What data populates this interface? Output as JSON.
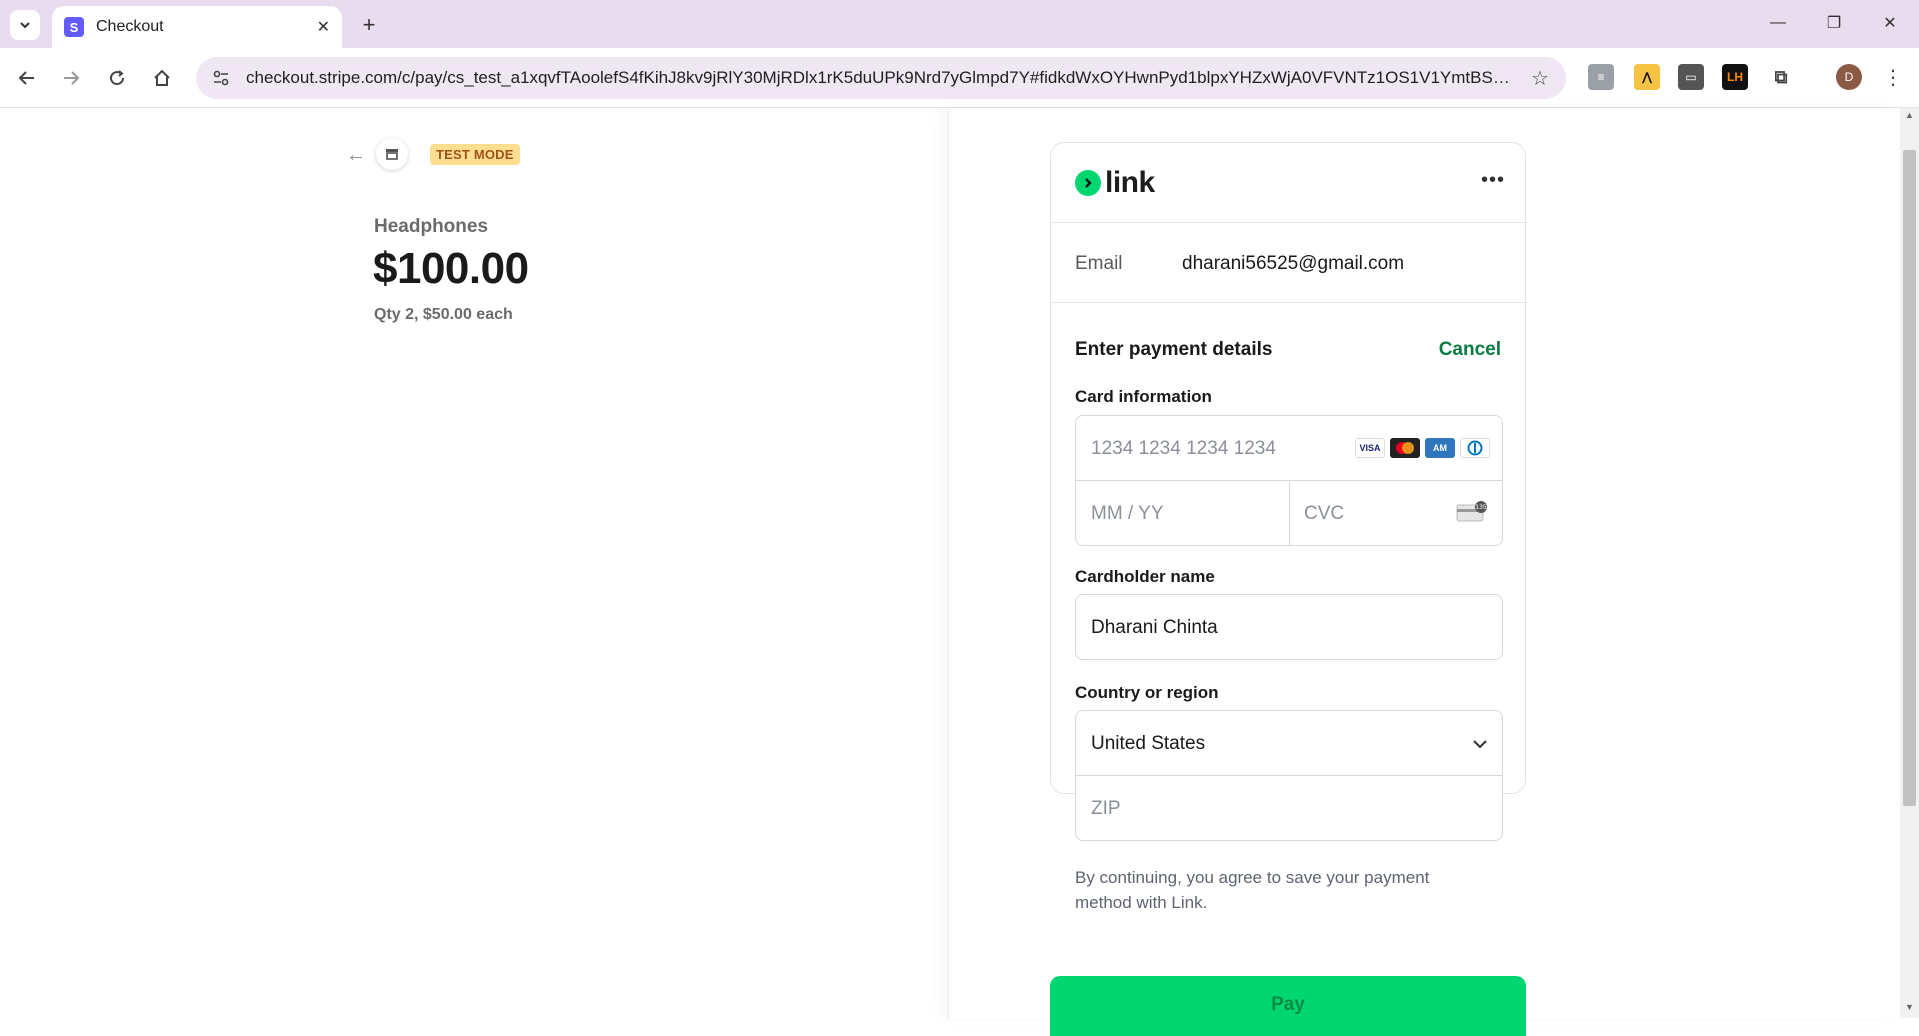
{
  "browser": {
    "tab_title": "Checkout",
    "url": "checkout.stripe.com/c/pay/cs_test_a1xqvfTAoolefS4fKihJ8kv9jRlY30MjRDlx1rK5duUPk9Nrd7yGlmpd7Y#fidkdWxOYHwnPyd1blpxYHZxWjA0VFVNTz1OS1V1YmtBSX...",
    "avatar_initial": "D",
    "extensions": [
      "ext-1-icon",
      "ext-2-icon",
      "ext-3-icon",
      "LH"
    ]
  },
  "summary": {
    "test_mode_label": "TEST MODE",
    "product_name": "Headphones",
    "price": "$100.00",
    "qty_text": "Qty 2, $50.00 each"
  },
  "link": {
    "brand": "link",
    "email_label": "Email",
    "email_value": "dharani56525@gmail.com",
    "section_title": "Enter payment details",
    "cancel_label": "Cancel",
    "card_info_label": "Card information",
    "card_number_placeholder": "1234 1234 1234 1234",
    "expiry_placeholder": "MM / YY",
    "cvc_placeholder": "CVC",
    "card_brands": [
      "VISA",
      "MC",
      "AMEX",
      "DC"
    ],
    "cardholder_label": "Cardholder name",
    "cardholder_value": "Dharani Chinta",
    "country_label": "Country or region",
    "country_value": "United States",
    "zip_placeholder": "ZIP",
    "notice": "By continuing, you agree to save your payment method with Link.",
    "pay_label": "Pay"
  },
  "colors": {
    "accent_green": "#00d66f",
    "link_green": "#0a7c42",
    "test_mode_bg": "#ffde92",
    "stripe_purple": "#635bff"
  }
}
